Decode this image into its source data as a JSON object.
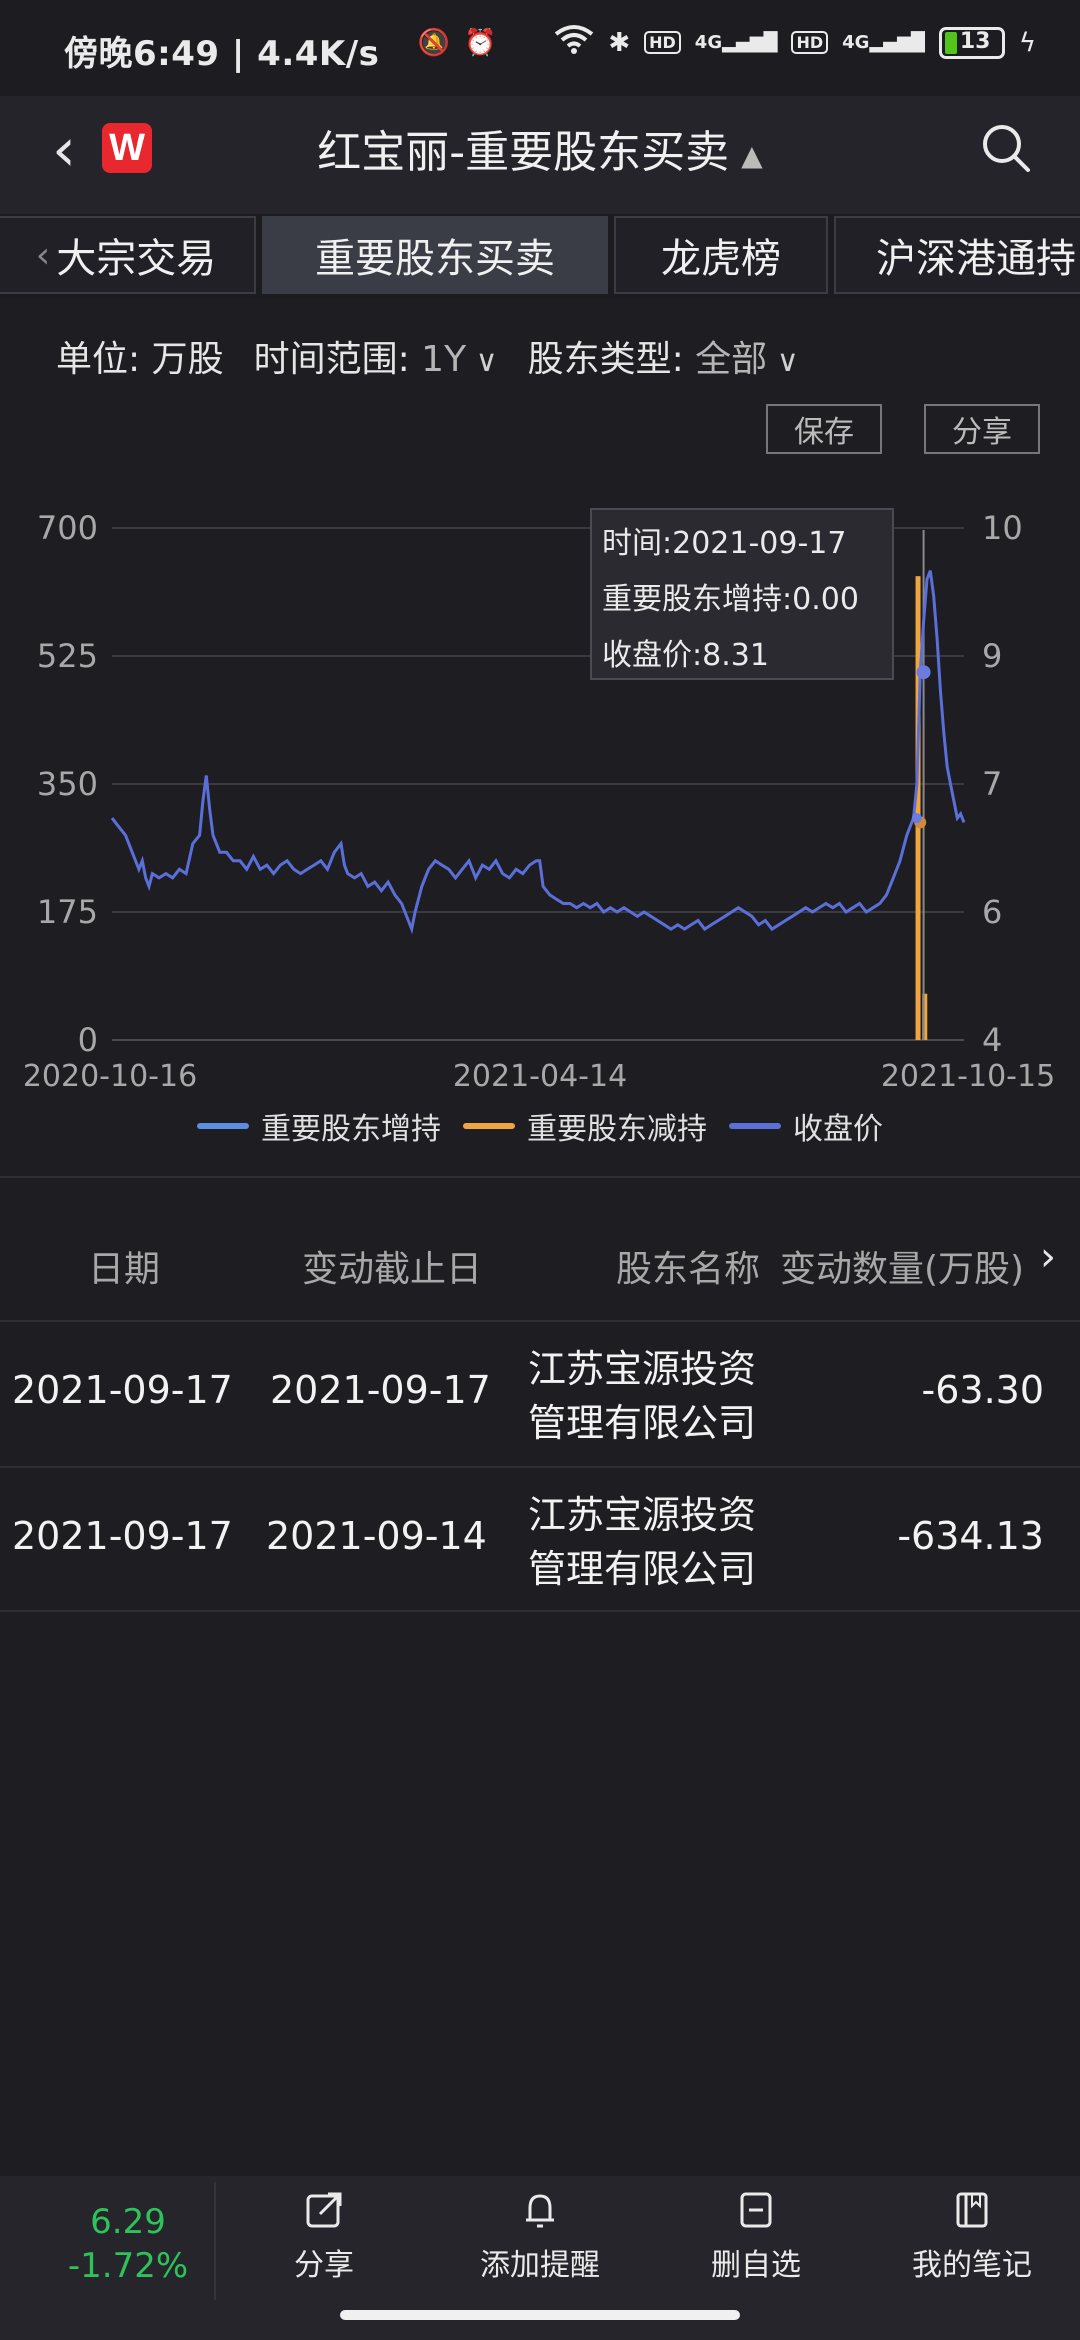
{
  "status": {
    "time_speed": "傍晚6:49 | 4.4K/s",
    "battery": "13",
    "net1": "4G",
    "net2": "4G",
    "hd": "HD"
  },
  "header": {
    "logo": "W",
    "title": "红宝丽-重要股东买卖"
  },
  "tabs": [
    {
      "label": "大宗交易"
    },
    {
      "label": "重要股东买卖"
    },
    {
      "label": "龙虎榜"
    },
    {
      "label": "沪深港通持"
    }
  ],
  "filters": {
    "unit_label": "单位: 万股",
    "range_label": "时间范围:",
    "range_value": "1Y",
    "type_label": "股东类型:",
    "type_value": "全部"
  },
  "buttons": {
    "save": "保存",
    "share": "分享"
  },
  "tooltip": {
    "line1": "时间:2021-09-17",
    "line2": "重要股东增持:0.00",
    "line3": "收盘价:8.31"
  },
  "chart_data": {
    "type": "line",
    "title": "",
    "categories_x": [
      "2020-10-16",
      "2021-04-14",
      "2021-10-15"
    ],
    "yleft_ticks": [
      "700",
      "525",
      "350",
      "175",
      "0"
    ],
    "yright_ticks": [
      "10",
      "9",
      "7",
      "6",
      "4"
    ],
    "ylim_left": [
      0,
      700
    ],
    "ylim_right": [
      4,
      10
    ],
    "grid": true,
    "legend_position": "bottom",
    "series": [
      {
        "name": "重要股东增持",
        "color": "#5a8ee0",
        "values": []
      },
      {
        "name": "重要股东减持",
        "color": "#f0a640",
        "bars": [
          {
            "date": "2021-09-14",
            "value": 634.13
          },
          {
            "date": "2021-09-17",
            "value": 63.3
          }
        ]
      },
      {
        "name": "收盘价",
        "color": "#5b6fd8",
        "points": [
          [
            0,
            6.6
          ],
          [
            2,
            6.5
          ],
          [
            4,
            6.4
          ],
          [
            6,
            6.2
          ],
          [
            8,
            6.0
          ],
          [
            9,
            6.1
          ],
          [
            10,
            5.9
          ],
          [
            11,
            5.8
          ],
          [
            12,
            5.95
          ],
          [
            14,
            5.9
          ],
          [
            16,
            5.95
          ],
          [
            18,
            5.9
          ],
          [
            20,
            6.0
          ],
          [
            22,
            5.95
          ],
          [
            24,
            6.3
          ],
          [
            26,
            6.4
          ],
          [
            27,
            6.8
          ],
          [
            28,
            7.1
          ],
          [
            29,
            6.7
          ],
          [
            30,
            6.4
          ],
          [
            32,
            6.2
          ],
          [
            34,
            6.2
          ],
          [
            36,
            6.1
          ],
          [
            38,
            6.1
          ],
          [
            40,
            6.0
          ],
          [
            42,
            6.15
          ],
          [
            44,
            6.0
          ],
          [
            46,
            6.05
          ],
          [
            48,
            5.95
          ],
          [
            50,
            6.05
          ],
          [
            52,
            6.1
          ],
          [
            54,
            6.0
          ],
          [
            56,
            5.95
          ],
          [
            58,
            6.0
          ],
          [
            60,
            6.05
          ],
          [
            62,
            6.1
          ],
          [
            64,
            6.0
          ],
          [
            66,
            6.2
          ],
          [
            68,
            6.3
          ],
          [
            69,
            6.05
          ],
          [
            70,
            5.95
          ],
          [
            72,
            5.9
          ],
          [
            74,
            5.95
          ],
          [
            76,
            5.8
          ],
          [
            78,
            5.85
          ],
          [
            80,
            5.75
          ],
          [
            82,
            5.85
          ],
          [
            84,
            5.7
          ],
          [
            86,
            5.6
          ],
          [
            88,
            5.4
          ],
          [
            89,
            5.3
          ],
          [
            90,
            5.5
          ],
          [
            92,
            5.8
          ],
          [
            94,
            6.0
          ],
          [
            96,
            6.1
          ],
          [
            98,
            6.05
          ],
          [
            100,
            6.0
          ],
          [
            102,
            5.9
          ],
          [
            104,
            6.0
          ],
          [
            106,
            6.1
          ],
          [
            108,
            5.9
          ],
          [
            110,
            6.05
          ],
          [
            112,
            6.0
          ],
          [
            114,
            6.1
          ],
          [
            116,
            5.95
          ],
          [
            118,
            5.9
          ],
          [
            120,
            6.0
          ],
          [
            122,
            5.95
          ],
          [
            124,
            6.05
          ],
          [
            126,
            6.1
          ],
          [
            127,
            6.1
          ],
          [
            128,
            5.8
          ],
          [
            130,
            5.7
          ],
          [
            132,
            5.65
          ],
          [
            134,
            5.6
          ],
          [
            136,
            5.6
          ],
          [
            138,
            5.55
          ],
          [
            140,
            5.6
          ],
          [
            142,
            5.55
          ],
          [
            144,
            5.6
          ],
          [
            146,
            5.5
          ],
          [
            148,
            5.55
          ],
          [
            150,
            5.5
          ],
          [
            152,
            5.55
          ],
          [
            154,
            5.5
          ],
          [
            156,
            5.45
          ],
          [
            158,
            5.5
          ],
          [
            160,
            5.45
          ],
          [
            162,
            5.4
          ],
          [
            164,
            5.35
          ],
          [
            166,
            5.3
          ],
          [
            168,
            5.35
          ],
          [
            170,
            5.3
          ],
          [
            172,
            5.35
          ],
          [
            174,
            5.4
          ],
          [
            176,
            5.3
          ],
          [
            178,
            5.35
          ],
          [
            180,
            5.4
          ],
          [
            182,
            5.45
          ],
          [
            184,
            5.5
          ],
          [
            186,
            5.55
          ],
          [
            188,
            5.5
          ],
          [
            190,
            5.45
          ],
          [
            192,
            5.35
          ],
          [
            194,
            5.4
          ],
          [
            196,
            5.3
          ],
          [
            198,
            5.35
          ],
          [
            200,
            5.4
          ],
          [
            202,
            5.45
          ],
          [
            204,
            5.5
          ],
          [
            206,
            5.55
          ],
          [
            208,
            5.5
          ],
          [
            210,
            5.55
          ],
          [
            212,
            5.6
          ],
          [
            214,
            5.55
          ],
          [
            216,
            5.6
          ],
          [
            218,
            5.5
          ],
          [
            220,
            5.55
          ],
          [
            222,
            5.6
          ],
          [
            224,
            5.5
          ],
          [
            226,
            5.55
          ],
          [
            228,
            5.6
          ],
          [
            230,
            5.7
          ],
          [
            232,
            5.9
          ],
          [
            234,
            6.1
          ],
          [
            236,
            6.4
          ],
          [
            238,
            6.6
          ],
          [
            239,
            7.0
          ],
          [
            240,
            8.3
          ],
          [
            241,
            8.9
          ],
          [
            242,
            9.4
          ],
          [
            243,
            9.5
          ],
          [
            244,
            9.2
          ],
          [
            245,
            8.7
          ],
          [
            246,
            8.1
          ],
          [
            247,
            7.6
          ],
          [
            248,
            7.2
          ],
          [
            249,
            7.0
          ],
          [
            250,
            6.8
          ],
          [
            251,
            6.6
          ],
          [
            252,
            6.65
          ],
          [
            253,
            6.55
          ]
        ]
      }
    ]
  },
  "table": {
    "headers": [
      "日期",
      "变动截止日",
      "股东名称",
      "变动数量(万股)"
    ],
    "rows": [
      {
        "date": "2021-09-17",
        "end_date": "2021-09-17",
        "name": "江苏宝源投资管理有限公司",
        "qty": "-63.30"
      },
      {
        "date": "2021-09-17",
        "end_date": "2021-09-14",
        "name": "江苏宝源投资管理有限公司",
        "qty": "-634.13"
      }
    ]
  },
  "bottom": {
    "price": "6.29",
    "change": "-1.72%",
    "share": "分享",
    "alert": "添加提醒",
    "remove": "删自选",
    "notes": "我的笔记"
  }
}
